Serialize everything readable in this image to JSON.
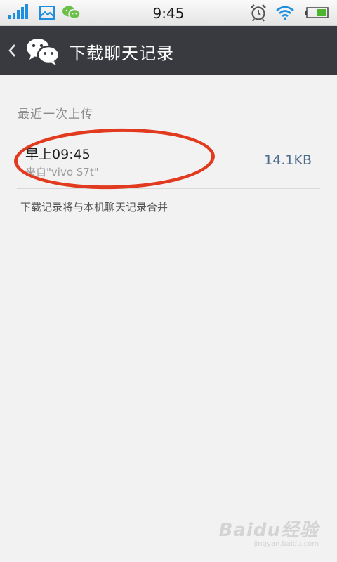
{
  "status_bar": {
    "time": "9:45",
    "icons": [
      "signal-icon",
      "gallery-icon",
      "wechat-icon",
      "alarm-icon",
      "wifi-icon",
      "battery-icon"
    ]
  },
  "header": {
    "title": "下载聊天记录",
    "back_icon": "chevron-left-icon",
    "logo_icon": "wechat-logo-icon"
  },
  "content": {
    "section_label": "最近一次上传",
    "record": {
      "time": "早上09:45",
      "source": "来自\"vivo S7t\"",
      "size": "14.1KB"
    },
    "hint": "下载记录将与本机聊天记录合并"
  },
  "watermark": {
    "text": "Baidu经验",
    "url": "jingyan.baidu.com"
  },
  "colors": {
    "header_bg": "#393a3f",
    "annotation": "#e23a1e",
    "accent_size": "#4a6a8c",
    "page_bg": "#f2f2f2"
  }
}
